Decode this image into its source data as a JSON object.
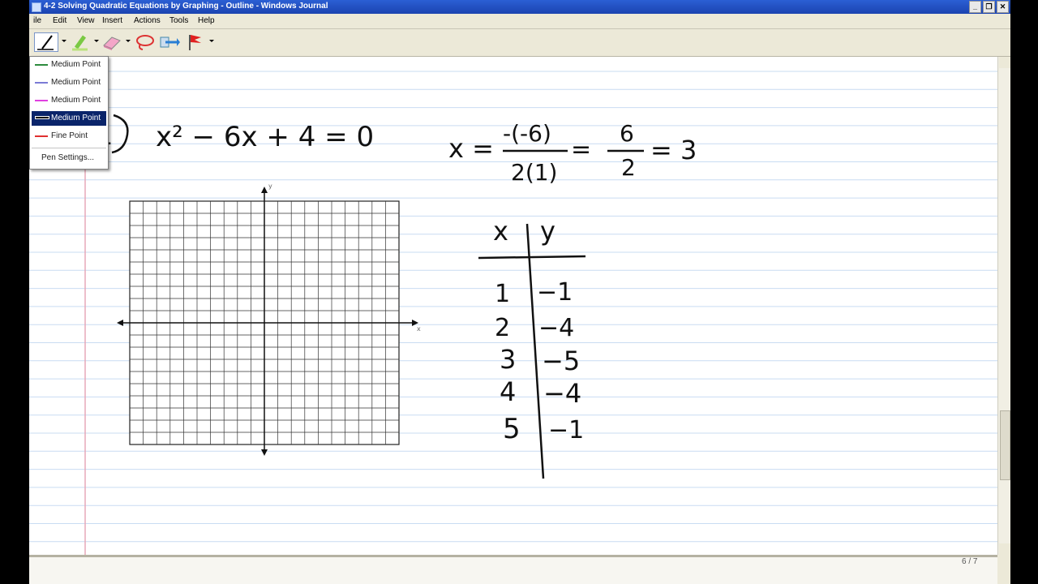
{
  "window": {
    "title": "4-2  Solving Quadratic Equations by Graphing - Outline - Windows Journal",
    "buttons": [
      "_",
      "❐",
      "✕"
    ]
  },
  "menubar": {
    "items": [
      "ile",
      "Edit",
      "View",
      "Insert",
      "Actions",
      "Tools",
      "Help"
    ]
  },
  "pen_menu": {
    "items": [
      {
        "label": "Medium Point",
        "color": "#2e8b3e"
      },
      {
        "label": "Medium Point",
        "color": "#7b7bd6"
      },
      {
        "label": "Medium Point",
        "color": "#e040e0"
      },
      {
        "label": "Medium Point",
        "color": "#000000"
      },
      {
        "label": "Fine Point",
        "color": "#e03030"
      }
    ],
    "selected_index": 3,
    "settings_label": "Pen Settings..."
  },
  "notes": {
    "problem_number": "1",
    "equation": "x² − 6x + 4 = 0",
    "vertex_formula": "x = −(−6) / 2(1) = 6/2 = 3",
    "axis_x_label": "x",
    "axis_y_label": "y",
    "table": {
      "headers": [
        "x",
        "y"
      ],
      "rows": [
        [
          "1",
          "−1"
        ],
        [
          "2",
          "−4"
        ],
        [
          "3",
          "−5"
        ],
        [
          "4",
          "−4"
        ],
        [
          "5",
          "−1"
        ]
      ]
    }
  },
  "status": {
    "page": "6 / 7"
  },
  "colors": {
    "ruled_line": "#c9dcf2",
    "margin_line": "#e7a8b8",
    "ink": "#111111"
  }
}
